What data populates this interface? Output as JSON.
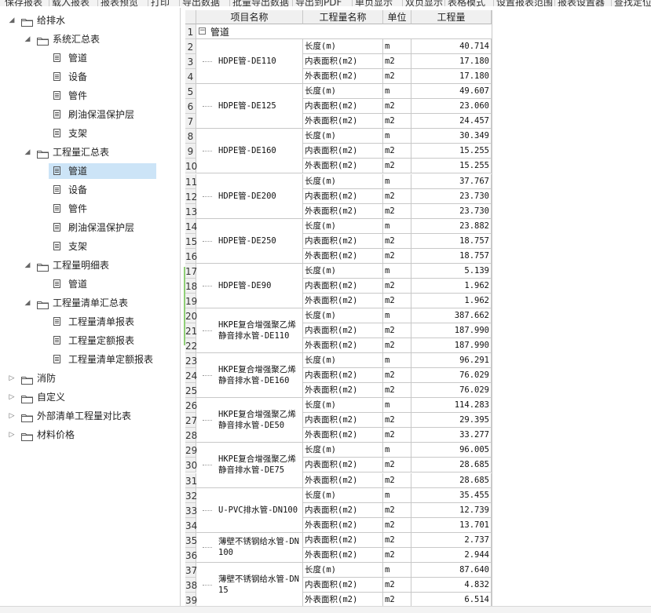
{
  "toolbar": {
    "items": [
      "保存报表",
      "载入报表",
      "报表预览",
      "打印",
      "导出数据",
      "批量导出数据",
      "导出到PDF",
      "单页显示",
      "双页显示",
      "表格模式",
      "设置报表范围",
      "报表设置器",
      "查找定位"
    ]
  },
  "tree": {
    "nodes": [
      {
        "label": "给排水",
        "level": 0,
        "type": "folder",
        "expanded": true
      },
      {
        "label": "系统汇总表",
        "level": 1,
        "type": "folder",
        "expanded": true
      },
      {
        "label": "管道",
        "level": 2,
        "type": "doc"
      },
      {
        "label": "设备",
        "level": 2,
        "type": "doc"
      },
      {
        "label": "管件",
        "level": 2,
        "type": "doc"
      },
      {
        "label": "刷油保温保护层",
        "level": 2,
        "type": "doc"
      },
      {
        "label": "支架",
        "level": 2,
        "type": "doc"
      },
      {
        "label": "工程量汇总表",
        "level": 1,
        "type": "folder",
        "expanded": true
      },
      {
        "label": "管道",
        "level": 2,
        "type": "doc",
        "selected": true
      },
      {
        "label": "设备",
        "level": 2,
        "type": "doc"
      },
      {
        "label": "管件",
        "level": 2,
        "type": "doc"
      },
      {
        "label": "刷油保温保护层",
        "level": 2,
        "type": "doc"
      },
      {
        "label": "支架",
        "level": 2,
        "type": "doc"
      },
      {
        "label": "工程量明细表",
        "level": 1,
        "type": "folder",
        "expanded": true
      },
      {
        "label": "管道",
        "level": 2,
        "type": "doc"
      },
      {
        "label": "工程量清单汇总表",
        "level": 1,
        "type": "folder",
        "expanded": true
      },
      {
        "label": "工程量清单报表",
        "level": 2,
        "type": "doc"
      },
      {
        "label": "工程量定额报表",
        "level": 2,
        "type": "doc"
      },
      {
        "label": "工程量清单定额报表",
        "level": 2,
        "type": "doc"
      },
      {
        "label": "消防",
        "level": 0,
        "type": "folder",
        "expanded": false
      },
      {
        "label": "自定义",
        "level": 0,
        "type": "folder",
        "expanded": false
      },
      {
        "label": "外部清单工程量对比表",
        "level": 0,
        "type": "folder",
        "expanded": false
      },
      {
        "label": "材料价格",
        "level": 0,
        "type": "folder",
        "expanded": false
      }
    ]
  },
  "grid": {
    "headers": [
      "项目名称",
      "工程量名称",
      "单位",
      "工程量"
    ],
    "group": "管道",
    "items": [
      {
        "name": "HDPE管-DE110",
        "rows": [
          {
            "m": "长度(m)",
            "u": "m",
            "q": "40.714"
          },
          {
            "m": "内表面积(m2)",
            "u": "m2",
            "q": "17.180"
          },
          {
            "m": "外表面积(m2)",
            "u": "m2",
            "q": "17.180"
          }
        ]
      },
      {
        "name": "HDPE管-DE125",
        "rows": [
          {
            "m": "长度(m)",
            "u": "m",
            "q": "49.607"
          },
          {
            "m": "内表面积(m2)",
            "u": "m2",
            "q": "23.060"
          },
          {
            "m": "外表面积(m2)",
            "u": "m2",
            "q": "24.457"
          }
        ]
      },
      {
        "name": "HDPE管-DE160",
        "rows": [
          {
            "m": "长度(m)",
            "u": "m",
            "q": "30.349"
          },
          {
            "m": "内表面积(m2)",
            "u": "m2",
            "q": "15.255"
          },
          {
            "m": "外表面积(m2)",
            "u": "m2",
            "q": "15.255"
          }
        ]
      },
      {
        "name": "HDPE管-DE200",
        "rows": [
          {
            "m": "长度(m)",
            "u": "m",
            "q": "37.767"
          },
          {
            "m": "内表面积(m2)",
            "u": "m2",
            "q": "23.730"
          },
          {
            "m": "外表面积(m2)",
            "u": "m2",
            "q": "23.730"
          }
        ]
      },
      {
        "name": "HDPE管-DE250",
        "rows": [
          {
            "m": "长度(m)",
            "u": "m",
            "q": "23.882"
          },
          {
            "m": "内表面积(m2)",
            "u": "m2",
            "q": "18.757"
          },
          {
            "m": "外表面积(m2)",
            "u": "m2",
            "q": "18.757"
          }
        ]
      },
      {
        "name": "HDPE管-DE90",
        "rows": [
          {
            "m": "长度(m)",
            "u": "m",
            "q": "5.139"
          },
          {
            "m": "内表面积(m2)",
            "u": "m2",
            "q": "1.962"
          },
          {
            "m": "外表面积(m2)",
            "u": "m2",
            "q": "1.962"
          }
        ]
      },
      {
        "name": "HKPE复合增强聚乙烯静音排水管-DE110",
        "rows": [
          {
            "m": "长度(m)",
            "u": "m",
            "q": "387.662"
          },
          {
            "m": "内表面积(m2)",
            "u": "m2",
            "q": "187.990"
          },
          {
            "m": "外表面积(m2)",
            "u": "m2",
            "q": "187.990"
          }
        ]
      },
      {
        "name": "HKPE复合增强聚乙烯静音排水管-DE160",
        "rows": [
          {
            "m": "长度(m)",
            "u": "m",
            "q": "96.291"
          },
          {
            "m": "内表面积(m2)",
            "u": "m2",
            "q": "76.029"
          },
          {
            "m": "外表面积(m2)",
            "u": "m2",
            "q": "76.029"
          }
        ]
      },
      {
        "name": "HKPE复合增强聚乙烯静音排水管-DE50",
        "rows": [
          {
            "m": "长度(m)",
            "u": "m",
            "q": "114.283"
          },
          {
            "m": "内表面积(m2)",
            "u": "m2",
            "q": "29.395"
          },
          {
            "m": "外表面积(m2)",
            "u": "m2",
            "q": "33.277"
          }
        ]
      },
      {
        "name": "HKPE复合增强聚乙烯静音排水管-DE75",
        "rows": [
          {
            "m": "长度(m)",
            "u": "m",
            "q": "96.005"
          },
          {
            "m": "内表面积(m2)",
            "u": "m2",
            "q": "28.685"
          },
          {
            "m": "外表面积(m2)",
            "u": "m2",
            "q": "28.685"
          }
        ]
      },
      {
        "name": "U-PVC排水管-DN100",
        "rows": [
          {
            "m": "长度(m)",
            "u": "m",
            "q": "35.455"
          },
          {
            "m": "内表面积(m2)",
            "u": "m2",
            "q": "12.739"
          },
          {
            "m": "外表面积(m2)",
            "u": "m2",
            "q": "13.701"
          }
        ]
      },
      {
        "name": "薄壁不锈钢给水管-DN100",
        "rows": [
          {
            "m": "内表面积(m2)",
            "u": "m2",
            "q": "2.737"
          },
          {
            "m": "外表面积(m2)",
            "u": "m2",
            "q": "2.944"
          }
        ]
      },
      {
        "name": "薄壁不锈钢给水管-DN15",
        "rows": [
          {
            "m": "长度(m)",
            "u": "m",
            "q": "87.640"
          },
          {
            "m": "内表面积(m2)",
            "u": "m2",
            "q": "4.832"
          },
          {
            "m": "外表面积(m2)",
            "u": "m2",
            "q": "6.514"
          }
        ]
      }
    ]
  }
}
